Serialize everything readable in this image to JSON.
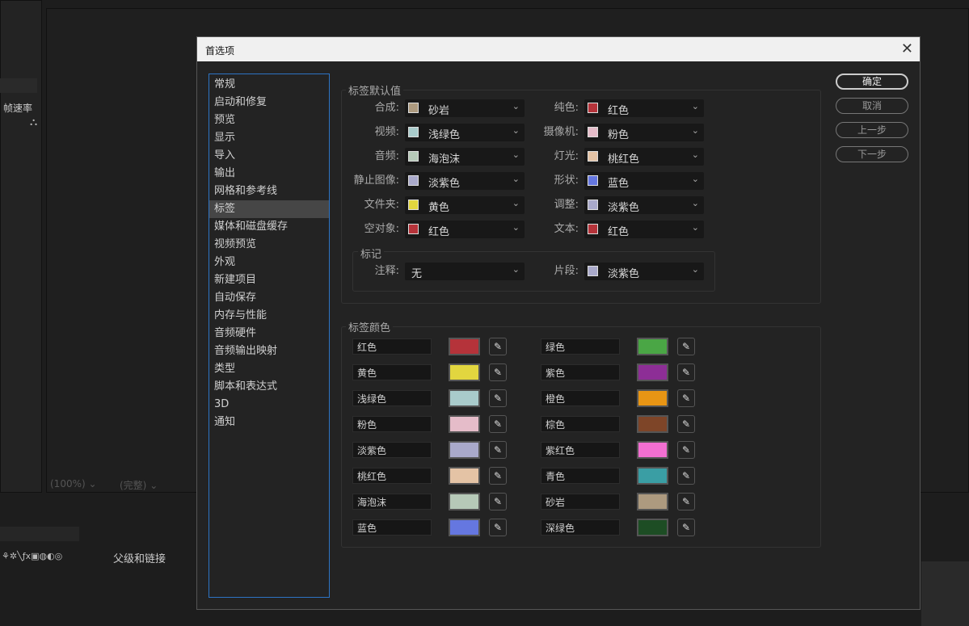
{
  "background": {
    "left_label": "帧速率",
    "zoom": "(100%)",
    "quality": "(完整)",
    "parent_link": "父级和链接"
  },
  "dialog": {
    "title": "首选项",
    "nav": [
      "常规",
      "启动和修复",
      "预览",
      "显示",
      "导入",
      "输出",
      "网格和参考线",
      "标签",
      "媒体和磁盘缓存",
      "视频预览",
      "外观",
      "新建项目",
      "自动保存",
      "内存与性能",
      "音频硬件",
      "音频输出映射",
      "类型",
      "脚本和表达式",
      "3D",
      "通知"
    ],
    "selected_nav": "标签",
    "buttons": {
      "ok": "确定",
      "cancel": "取消",
      "prev": "上一步",
      "next": "下一步"
    },
    "defaults": {
      "title": "标签默认值",
      "left": [
        {
          "label": "合成:",
          "value": "砂岩",
          "color": "#ad9a7f"
        },
        {
          "label": "视频:",
          "value": "浅绿色",
          "color": "#a9cbcb"
        },
        {
          "label": "音频:",
          "value": "海泡沫",
          "color": "#b6c9b8"
        },
        {
          "label": "静止图像:",
          "value": "淡紫色",
          "color": "#a9a9ca"
        },
        {
          "label": "文件夹:",
          "value": "黄色",
          "color": "#e2d63f"
        },
        {
          "label": "空对象:",
          "value": "红色",
          "color": "#b5333a"
        }
      ],
      "right": [
        {
          "label": "纯色:",
          "value": "红色",
          "color": "#b5333a"
        },
        {
          "label": "摄像机:",
          "value": "粉色",
          "color": "#e5bcc9"
        },
        {
          "label": "灯光:",
          "value": "桃红色",
          "color": "#e4c3a5"
        },
        {
          "label": "形状:",
          "value": "蓝色",
          "color": "#6577e0"
        },
        {
          "label": "调整:",
          "value": "淡紫色",
          "color": "#a9a9ca"
        },
        {
          "label": "文本:",
          "value": "红色",
          "color": "#b5333a"
        }
      ],
      "markers": {
        "title": "标记",
        "comment": {
          "label": "注释:",
          "value": "无"
        },
        "clip": {
          "label": "片段:",
          "value": "淡紫色",
          "color": "#a9a9ca"
        }
      }
    },
    "colors": {
      "title": "标签颜色",
      "left": [
        {
          "name": "红色",
          "color": "#b5333a"
        },
        {
          "name": "黄色",
          "color": "#e2d63f"
        },
        {
          "name": "浅绿色",
          "color": "#a9cbcb"
        },
        {
          "name": "粉色",
          "color": "#e5bcc9"
        },
        {
          "name": "淡紫色",
          "color": "#a9a9ca"
        },
        {
          "name": "桃红色",
          "color": "#e4c3a5"
        },
        {
          "name": "海泡沫",
          "color": "#b6c9b8"
        },
        {
          "name": "蓝色",
          "color": "#6577e0"
        }
      ],
      "right": [
        {
          "name": "绿色",
          "color": "#4aa645"
        },
        {
          "name": "紫色",
          "color": "#8d2e96"
        },
        {
          "name": "橙色",
          "color": "#e89514"
        },
        {
          "name": "棕色",
          "color": "#7e4528"
        },
        {
          "name": "紫红色",
          "color": "#f26fd1"
        },
        {
          "name": "青色",
          "color": "#3a9ea4"
        },
        {
          "name": "砂岩",
          "color": "#ad9a7f"
        },
        {
          "name": "深绿色",
          "color": "#1d4d24"
        }
      ]
    }
  }
}
